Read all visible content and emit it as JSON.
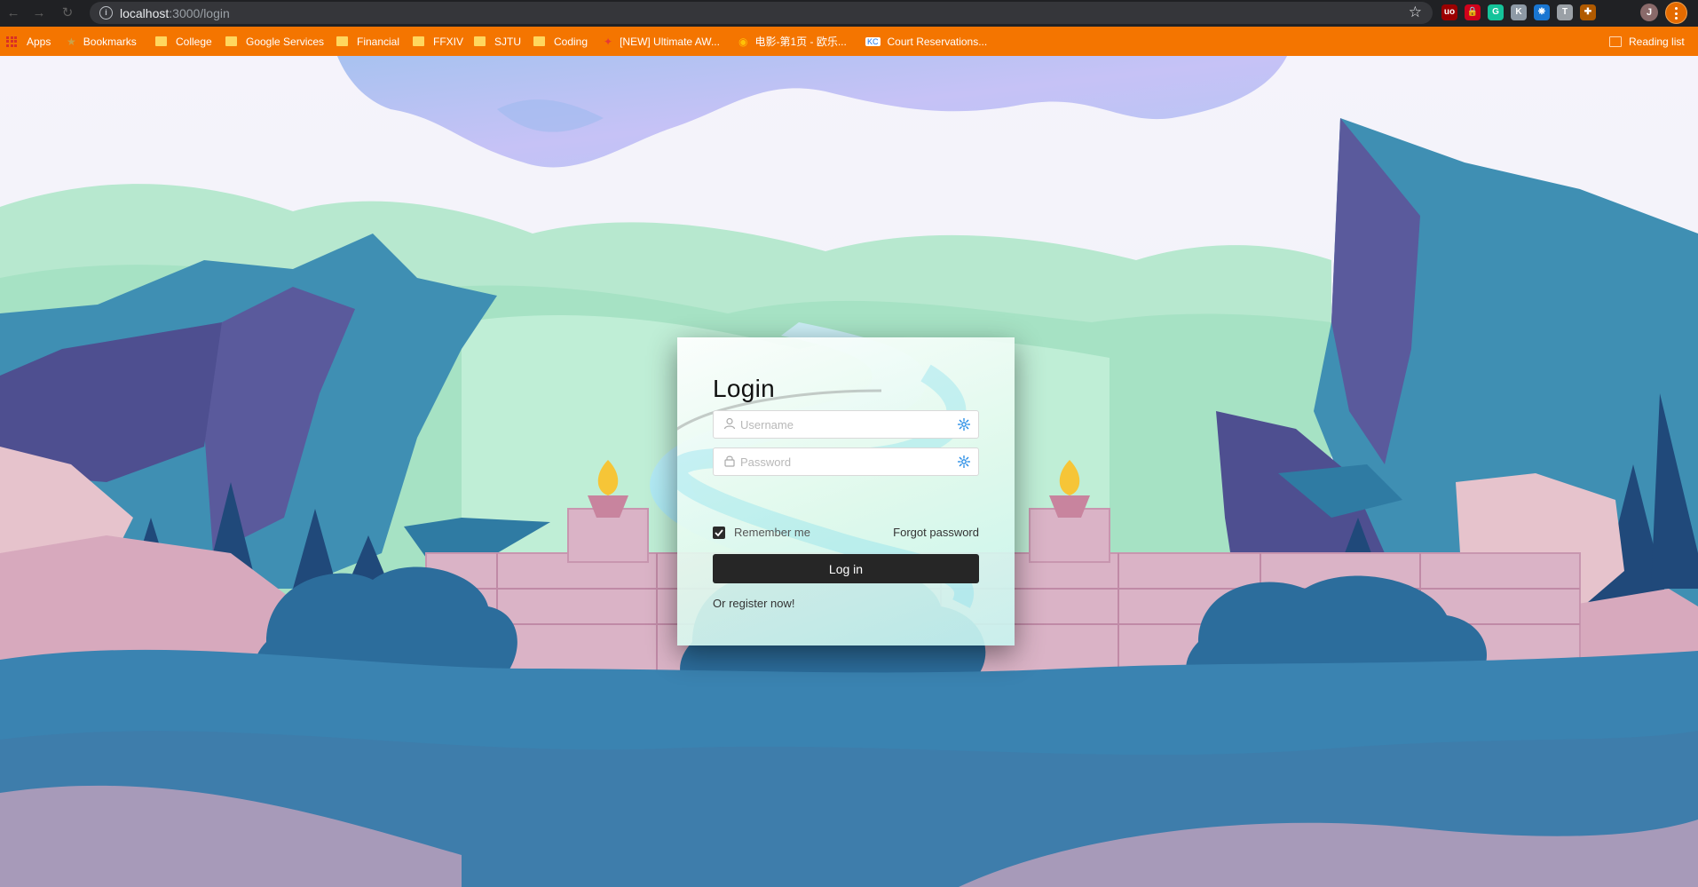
{
  "browser": {
    "url_host": "localhost",
    "url_path": ":3000/login",
    "extensions": [
      {
        "name": "ublock-origin-icon",
        "glyph": "uo",
        "color": "#9b0000"
      },
      {
        "name": "lock-extension-icon",
        "glyph": "🔒",
        "color": "#d0021b"
      },
      {
        "name": "grammarly-icon",
        "glyph": "G",
        "color": "#15c39a"
      },
      {
        "name": "image-extension-icon",
        "glyph": "K",
        "color": "#8e9aa6"
      },
      {
        "name": "snowflake-extension-icon",
        "glyph": "❋",
        "color": "#1976d2"
      },
      {
        "name": "translate-extension-icon",
        "glyph": "T",
        "color": "#9aa0a6"
      },
      {
        "name": "puzzle-extensions-icon",
        "glyph": "✚",
        "color": "#b05a00"
      }
    ],
    "profile_initial": "J"
  },
  "bookmarks": {
    "apps": "Apps",
    "items": [
      "Bookmarks",
      "College",
      "Google Services",
      "Financial",
      "FFXIV",
      "SJTU",
      "Coding",
      "[NEW] Ultimate AW...",
      "电影-第1页 - 欧乐...",
      "Court Reservations..."
    ],
    "reading_list": "Reading list"
  },
  "login": {
    "title": "Login",
    "username_placeholder": "Username",
    "password_placeholder": "Password",
    "remember_label": "Remember me",
    "remember_checked": true,
    "forgot_label": "Forgot password",
    "submit_label": "Log in",
    "register_prefix": "Or ",
    "register_link": "register now!"
  },
  "colors": {
    "bookmark_bar": "#f47500",
    "toolbar": "#202124",
    "button": "#262626"
  }
}
